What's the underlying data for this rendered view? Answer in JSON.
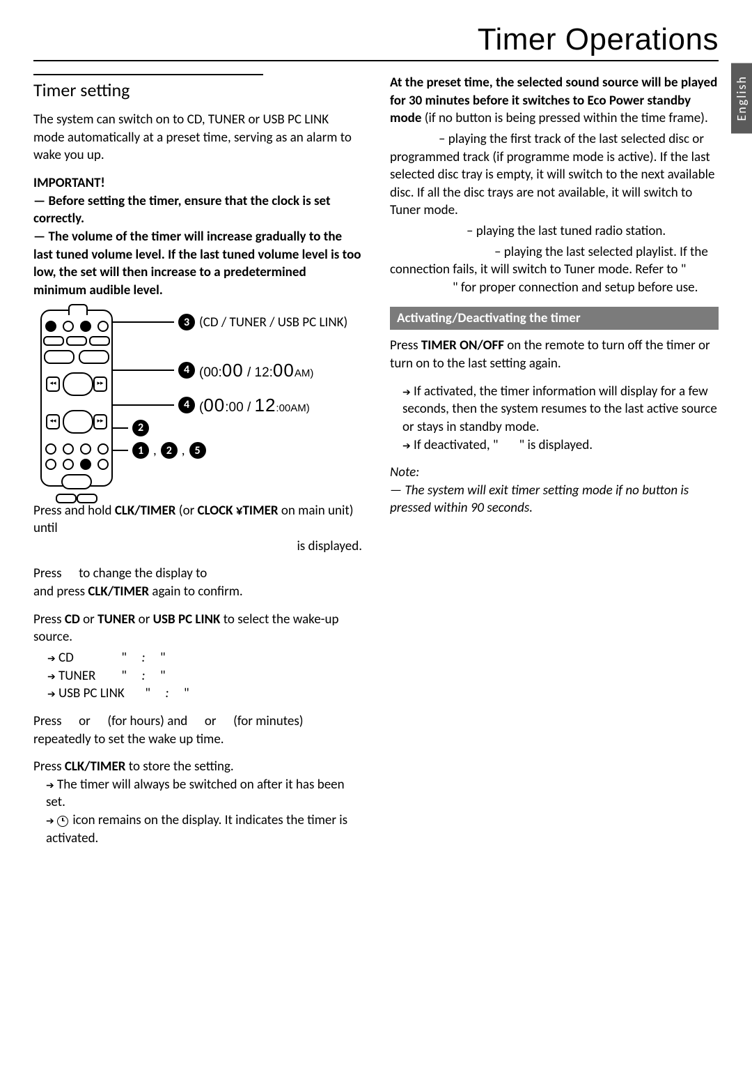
{
  "page": {
    "title": "Timer Operations",
    "lang_tab": "English"
  },
  "left": {
    "h2": "Timer setting",
    "intro": "The system can switch on to CD, TUNER or USB PC LINK mode automatically at a preset time, serving as an alarm to wake you up.",
    "important_label": "IMPORTANT!",
    "imp1": "— Before setting the timer, ensure that the clock is set correctly.",
    "imp2": "— The volume of the timer will increase gradually to the last tuned volume level. If the last tuned volume level is too low, the set will then increase to a predetermined minimum audible level.",
    "callouts": {
      "c3": "(CD / TUNER / USB PC LINK)",
      "c4a_pre": "(00:",
      "c4a_big": "00",
      "c4a_mid": " / 12:",
      "c4a_big2": "00",
      "c4a_suf": "AM)",
      "c4b_pre": "(",
      "c4b_big": "00",
      "c4b_mid": ":00 / ",
      "c4b_big2": "12",
      "c4b_suf": ":00AM)",
      "c2_label": "",
      "c125": ""
    },
    "s1a": "Press and hold ",
    "s1_btn1": "CLK/TIMER",
    "s1b": " (or ",
    "s1_btn2": "CLOCK ¥TIMER",
    "s1c": " on main unit) until",
    "s1d": " is displayed.",
    "s2a": "Press ",
    "s2b": " to change the display to ",
    "s2c": "and press ",
    "s2_btn": "CLK/TIMER",
    "s2d": " again to confirm.",
    "s3a": "Press ",
    "s3_cd": "CD",
    "s3b": " or ",
    "s3_tuner": "TUNER",
    "s3c": " or ",
    "s3_usb": "USB PC LINK",
    "s3d": " to select the wake-up source.",
    "src_cd_label": "CD",
    "src_cd_q1": "\"",
    "src_cd_colon": ":",
    "src_cd_q2": "\"",
    "src_tuner_label": "TUNER",
    "src_tuner_q1": "\"",
    "src_tuner_colon": ":",
    "src_tuner_q2": "\"",
    "src_usb_label": "USB PC LINK",
    "src_usb_q1": "\"",
    "src_usb_colon": ":",
    "src_usb_q2": "\"",
    "s4a": "Press ",
    "s4b": " or ",
    "s4c": " (for hours) and ",
    "s4d": " or ",
    "s4e": " (for minutes) repeatedly to set the wake up time.",
    "s5a": "Press ",
    "s5_btn": "CLK/TIMER",
    "s5b": " to store the setting.",
    "s5_note1": "The timer will always be switched on after it has been set.",
    "s5_note2a": " icon remains on the display. It indicates the timer is activated."
  },
  "right": {
    "p1a": "At the preset time, the selected sound source will be played for 30 minutes before it switches to Eco Power standby mode",
    "p1b": " (if no button is being pressed within the time frame).",
    "cd_line": "– playing the first track of the last selected disc or programmed track (if programme mode is active).  If the last selected disc tray is empty, it will switch to the next available disc.  If all the disc trays are not available, it will switch to Tuner mode.",
    "tuner_line": "– playing the last tuned radio station.",
    "usb_line_a": "– playing the last selected playlist.  If the connection fails, it will switch to Tuner mode.  Refer to \"",
    "usb_line_b": "\" for proper connection and setup before use.",
    "section_bar": "Activating/Deactivating the timer",
    "act1a": "Press ",
    "act1_btn": "TIMER ON/OFF",
    "act1b": " on the remote to turn off the timer or turn on to the last setting again.",
    "act2": "If activated, the timer information will display for a few seconds, then the system resumes to the last active source or stays in standby mode.",
    "act3a": "If deactivated, \"",
    "act3b": "\" is displayed.",
    "note_label": "Note:",
    "note_text": "— The system will exit timer setting mode if no button is pressed within 90 seconds."
  }
}
